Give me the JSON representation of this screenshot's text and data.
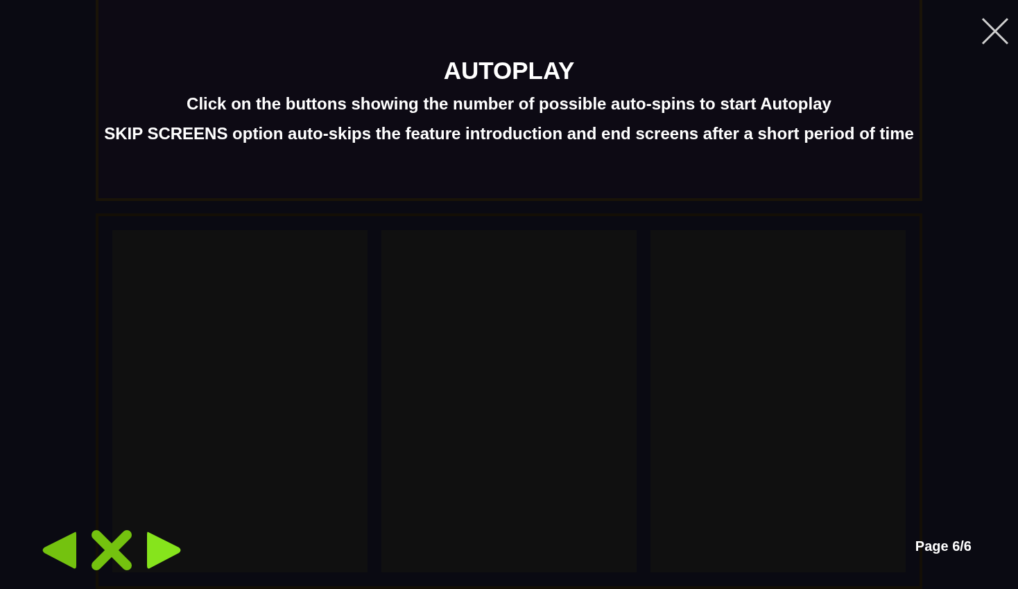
{
  "title": "AUTOPLAY",
  "paragraphs": [
    "Click on the buttons showing the number of possible auto-spins to start Autoplay",
    "SKIP SCREENS option auto-skips the feature introduction and end screens after a short period of time"
  ],
  "page_indicator": "Page 6/6"
}
